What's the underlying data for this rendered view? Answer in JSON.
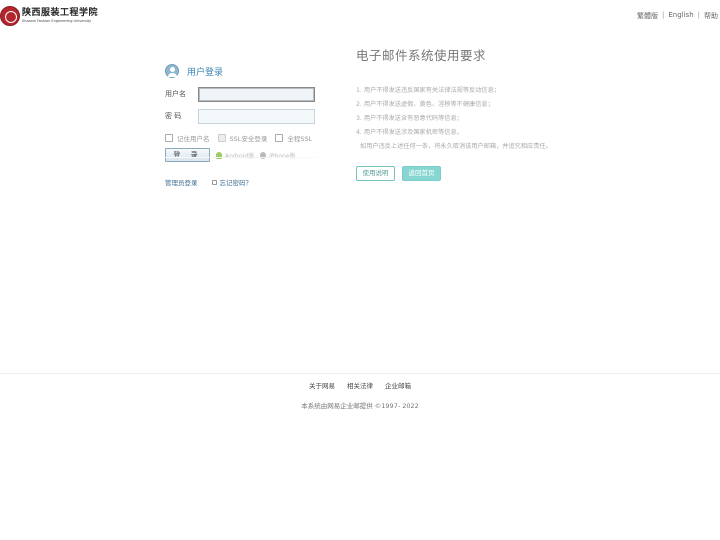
{
  "header": {
    "logo_cn": "陕西服装工程学院",
    "logo_en": "Shaanxi Fashion Engineering University",
    "links": [
      "繁體版",
      "English",
      "帮助"
    ]
  },
  "login": {
    "title": "用户登录",
    "username_label": "用户名",
    "password_label": "密  码",
    "username_value": "",
    "password_value": "",
    "options": [
      "记住用户名",
      "SSL安全登录",
      "全程SSL"
    ],
    "login_button": "登 录",
    "android_label": "Android版",
    "iphone_label": "iPhone版",
    "admin_login": "管理员登录",
    "forgot_password": "忘记密码？"
  },
  "requirements": {
    "title": "电子邮件系统使用要求",
    "items": [
      "1. 用户不得发送违反国家有关法律法规等反动信息；",
      "2. 用户不得发送虚假、黄色、淫秽等不健康信息；",
      "3. 用户不得发送含有恶意代码等信息；",
      "4. 用户不得发送涉及国家机密等信息。"
    ],
    "note": "如用户违反上述任何一条，将永久取消该用户邮箱，并追究相应责任。",
    "help_button": "使用说明",
    "back_button": "返回首页"
  },
  "footer": {
    "links": [
      "关于网易",
      "相关法律",
      "企业邮箱"
    ],
    "copyright": "本系统由网易企业邮提供 ©1997- 2022"
  }
}
